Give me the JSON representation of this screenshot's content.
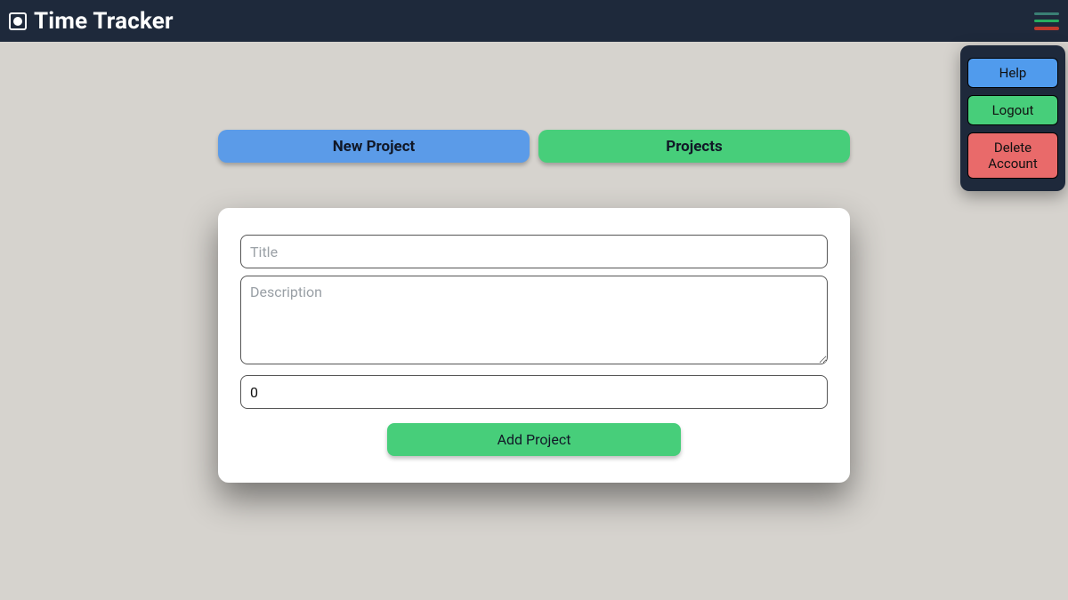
{
  "header": {
    "title": "Time Tracker"
  },
  "menu": {
    "help": "Help",
    "logout": "Logout",
    "delete": "Delete Account"
  },
  "tabs": {
    "new_project": "New Project",
    "projects": "Projects"
  },
  "form": {
    "title_placeholder": "Title",
    "title_value": "",
    "description_placeholder": "Description",
    "description_value": "",
    "time_value": "0",
    "submit_label": "Add Project"
  }
}
